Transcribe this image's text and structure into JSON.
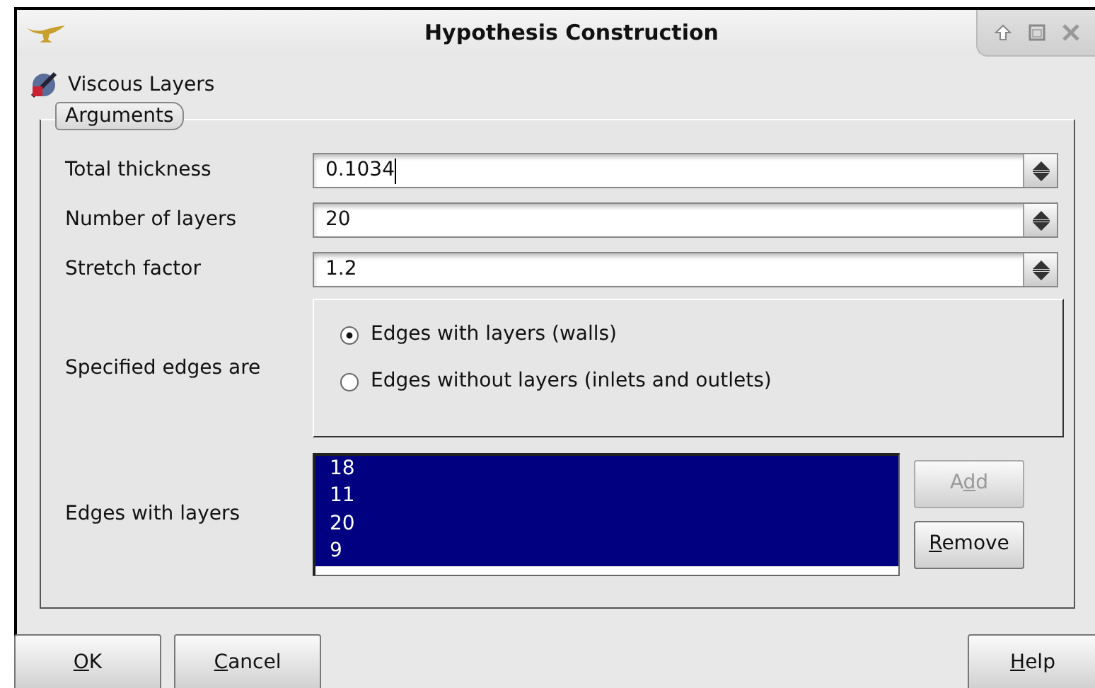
{
  "window": {
    "title": "Hypothesis Construction"
  },
  "hypothesis": {
    "name": "Viscous Layers"
  },
  "group": {
    "title": "Arguments"
  },
  "fields": [
    {
      "label": "Total thickness",
      "value": "0.1034",
      "focused": true
    },
    {
      "label": "Number of layers",
      "value": "20",
      "focused": false
    },
    {
      "label": "Stretch factor",
      "value": "1.2",
      "focused": false
    }
  ],
  "specified": {
    "label": "Specified edges are",
    "options": [
      {
        "label": "Edges with layers (walls)",
        "selected": true
      },
      {
        "label": "Edges without layers (inlets and outlets)",
        "selected": false
      }
    ]
  },
  "edges": {
    "label": "Edges with layers",
    "items": [
      {
        "text": "18",
        "selected": true
      },
      {
        "text": "11",
        "selected": true
      },
      {
        "text": "20",
        "selected": true
      },
      {
        "text": "9",
        "selected": true
      }
    ],
    "buttons": [
      {
        "label_start": "A",
        "mnemonic": "d",
        "label_end": "d",
        "disabled": true
      },
      {
        "mnemonic": "R",
        "label_end": "emove",
        "disabled": false
      }
    ]
  },
  "footer": [
    {
      "mnemonic": "O",
      "label_end": "K"
    },
    {
      "mnemonic": "C",
      "label_end": "ancel"
    },
    {
      "mnemonic": "H",
      "label_end": "elp"
    }
  ]
}
